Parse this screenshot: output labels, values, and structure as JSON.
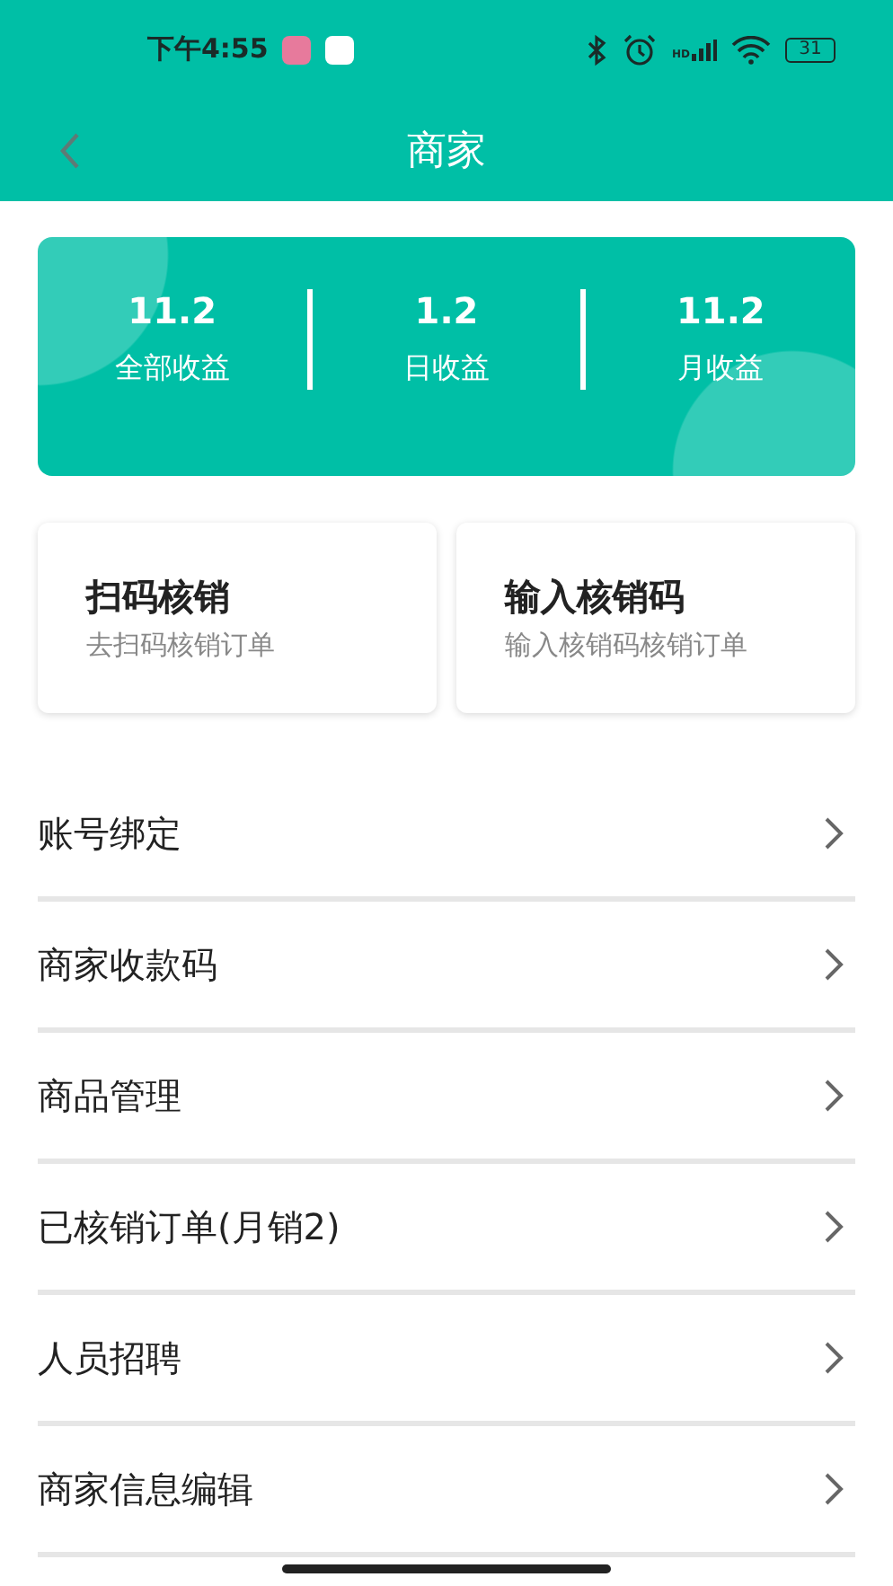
{
  "status_bar": {
    "time": "下午4:55",
    "network_label": "HD",
    "battery": "31"
  },
  "nav": {
    "title": "商家"
  },
  "stats": [
    {
      "value": "11.2",
      "label": "全部收益"
    },
    {
      "value": "1.2",
      "label": "日收益"
    },
    {
      "value": "11.2",
      "label": "月收益"
    }
  ],
  "actions": [
    {
      "title": "扫码核销",
      "subtitle": "去扫码核销订单"
    },
    {
      "title": "输入核销码",
      "subtitle": "输入核销码核销订单"
    }
  ],
  "menu": [
    {
      "label": "账号绑定"
    },
    {
      "label": "商家收款码"
    },
    {
      "label": "商品管理"
    },
    {
      "label": "已核销订单(月销2)"
    },
    {
      "label": "人员招聘"
    },
    {
      "label": "商家信息编辑"
    }
  ]
}
